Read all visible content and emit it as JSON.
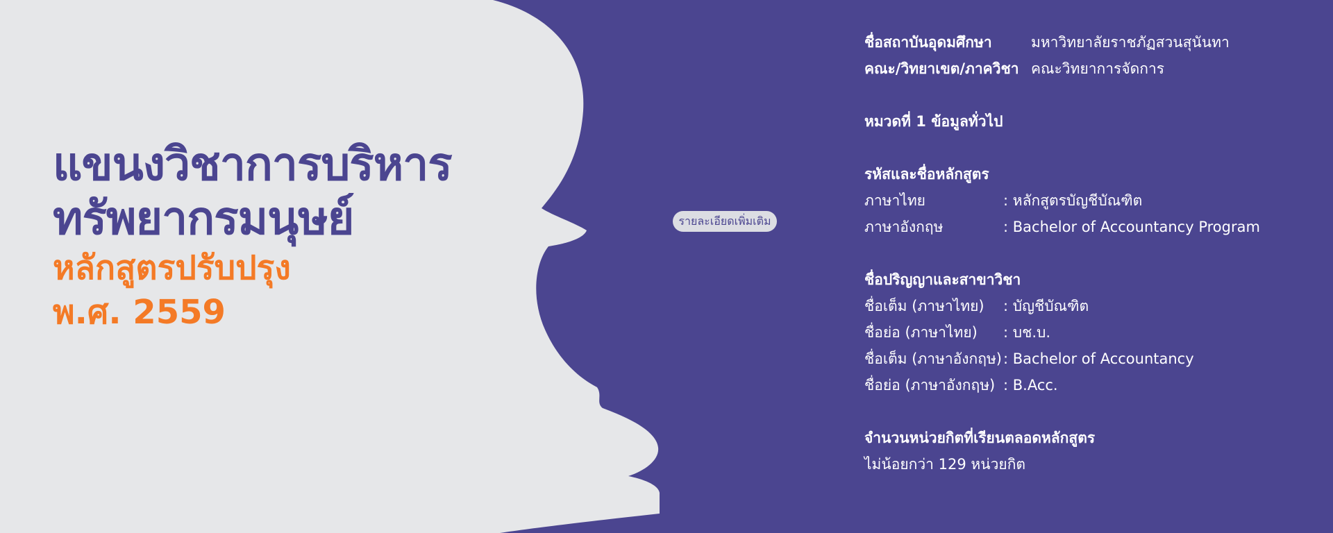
{
  "hero": {
    "title_line1": "แขนงวิชาการบริหาร",
    "title_line2": "ทรัพยากรมนุษย์",
    "subtitle_line1": "หลักสูตรปรับปรุง",
    "subtitle_line2": "พ.ศ. 2559"
  },
  "more_button": {
    "label": "รายละเอียดเพิ่มเติม"
  },
  "info": {
    "institution_label": "ชื่อสถาบันอุดมศึกษา",
    "institution_value": "มหาวิทยาลัยราชภัฏสวนสุนันทา",
    "faculty_label": "คณะ/วิทยาเขต/ภาควิชา",
    "faculty_value": "คณะวิทยาการจัดการ",
    "section_heading": "หมวดที่ 1 ข้อมูลทั่วไป",
    "program_heading": "รหัสและชื่อหลักสูตร",
    "program_rows": [
      {
        "label": "ภาษาไทย",
        "value": ": หลักสูตรบัญชีบัณฑิต"
      },
      {
        "label": "ภาษาอังกฤษ",
        "value": ": Bachelor of Accountancy Program"
      }
    ],
    "degree_heading": "ชื่อปริญญาและสาขาวิชา",
    "degree_rows": [
      {
        "label": "ชื่อเต็ม (ภาษาไทย)",
        "value": ": บัญชีบัณฑิต"
      },
      {
        "label": "ชื่อย่อ (ภาษาไทย)",
        "value": ": บช.บ."
      },
      {
        "label": "ชื่อเต็ม (ภาษาอังกฤษ)",
        "value": ": Bachelor of Accountancy"
      },
      {
        "label": "ชื่อย่อ (ภาษาอังกฤษ)",
        "value": ": B.Acc."
      }
    ],
    "credits_heading": "จำนวนหน่วยกิตที่เรียนตลอดหลักสูตร",
    "credits_value": "ไม่น้อยกว่า 129 หน่วยกิต"
  },
  "colors": {
    "background": "#4b4590",
    "silhouette": "#e6e7e9",
    "title": "#4b4590",
    "accent": "#f47a26",
    "text": "#ffffff"
  }
}
